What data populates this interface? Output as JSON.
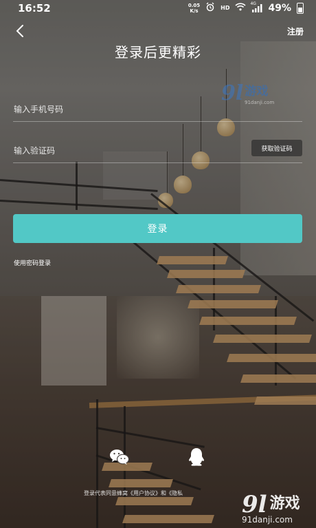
{
  "status_bar": {
    "time": "16:52",
    "net_speed_value": "0.05",
    "net_speed_unit": "K/s",
    "hd_label": "HD",
    "network_label": "4G",
    "battery": "49%"
  },
  "header": {
    "title": "登录后更精彩",
    "register_label": "注册"
  },
  "form": {
    "phone_placeholder": "输入手机号码",
    "code_placeholder": "输入验证码",
    "get_code_label": "获取验证码",
    "login_label": "登录",
    "password_login_label": "使用密码登录"
  },
  "social": {
    "icons": [
      "wechat-icon",
      "qq-icon"
    ]
  },
  "agreement": {
    "prefix": "登录代表同意蜂窝",
    "user_agreement": "《用户协议》",
    "and": "和",
    "privacy": "《隐私"
  },
  "watermark": {
    "logo_number": "9l",
    "logo_text": "游戏",
    "domain": "91danji.com"
  },
  "colors": {
    "accent": "#52c8c6",
    "text": "#ffffff"
  }
}
